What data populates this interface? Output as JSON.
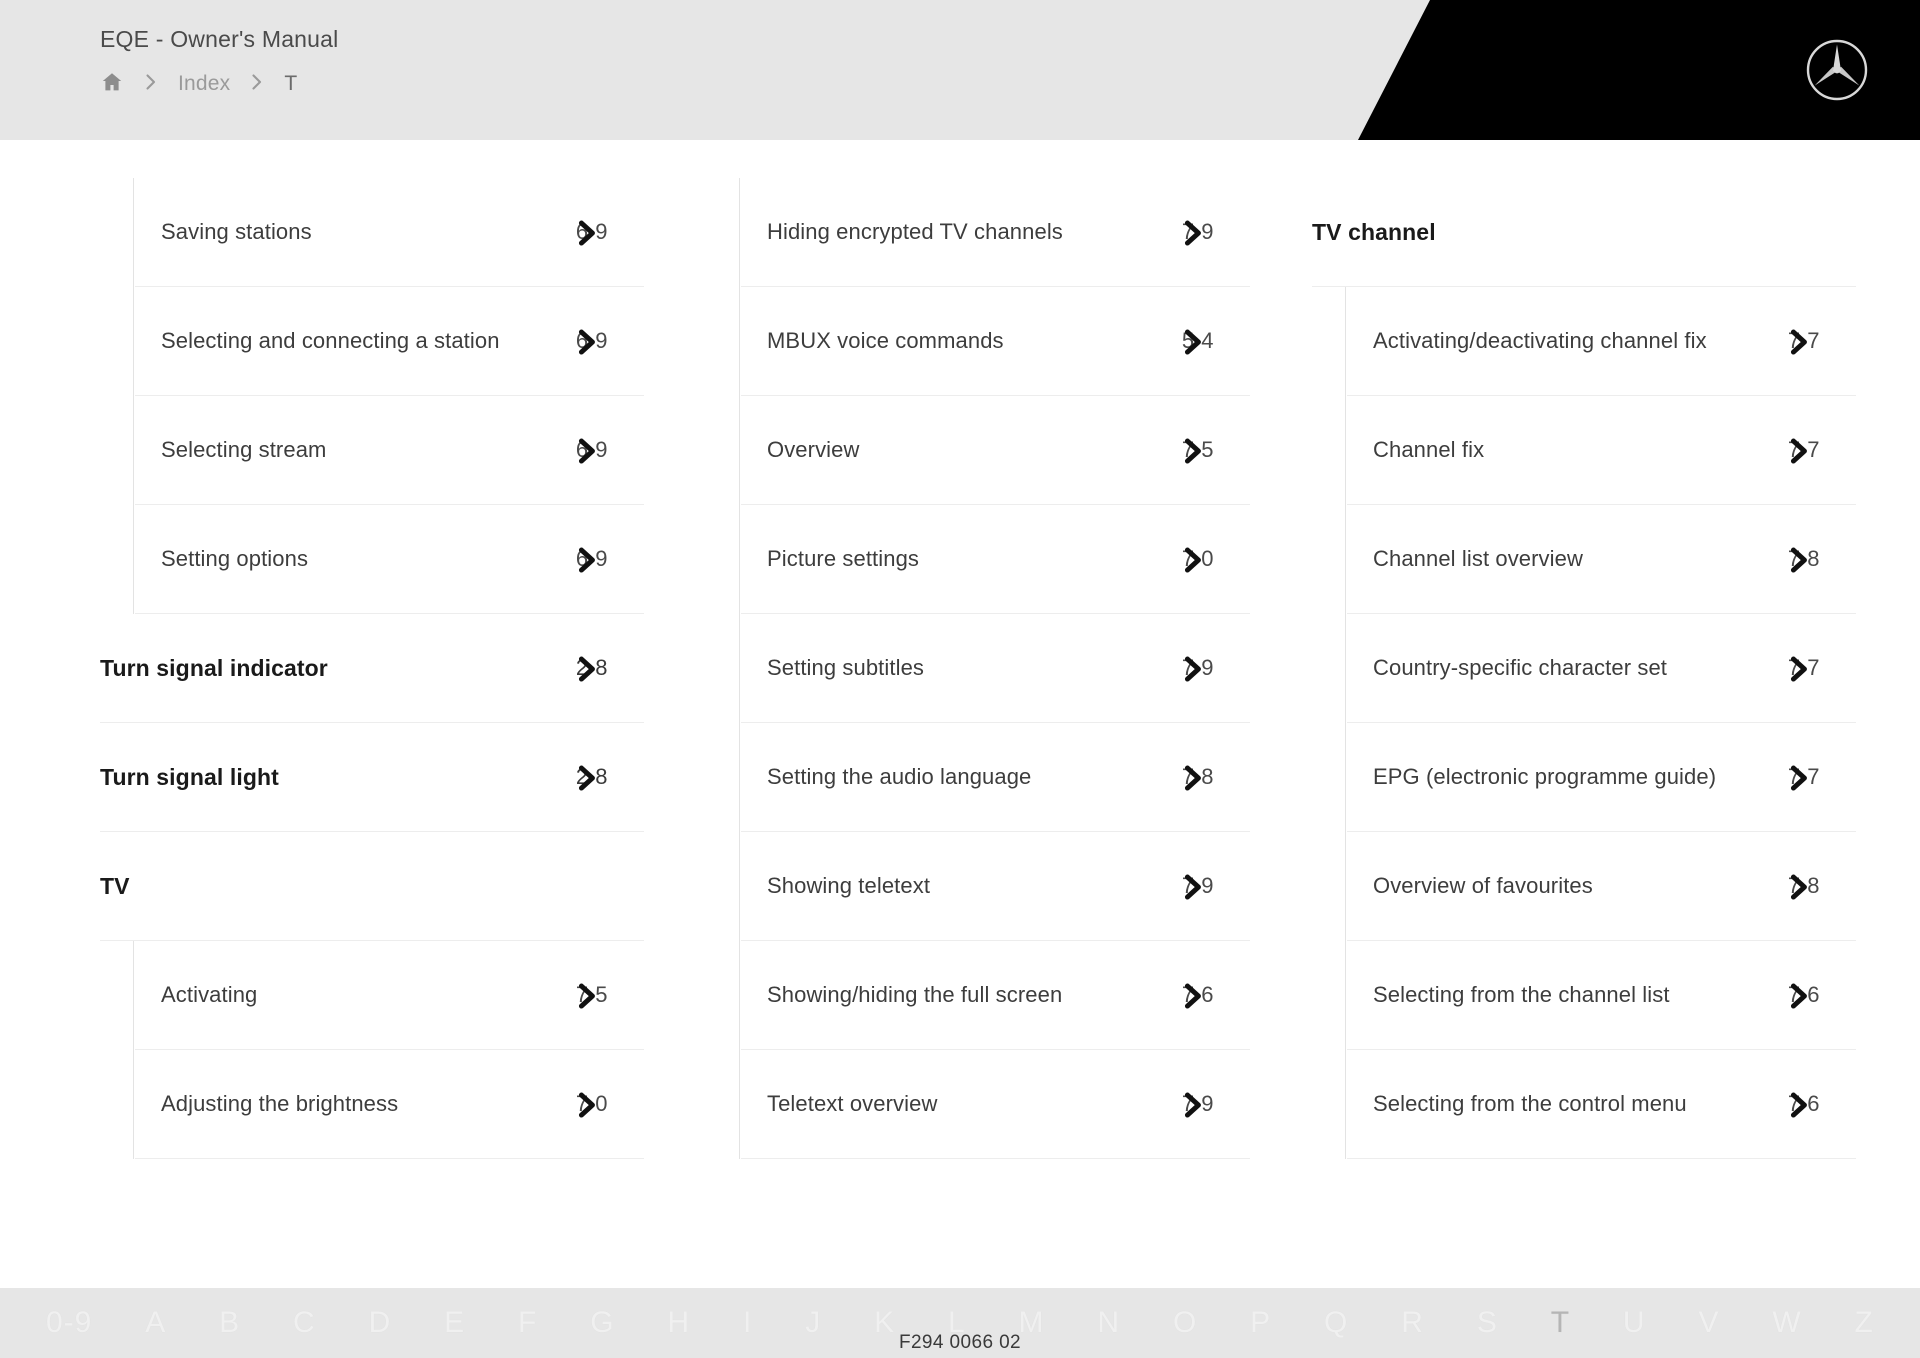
{
  "header": {
    "manual_title": "EQE - Owner's Manual",
    "breadcrumb": {
      "home_icon": "home-icon",
      "separator_icon": "chevron-right-icon",
      "items": [
        {
          "label": "Index",
          "current": false
        },
        {
          "label": "T",
          "current": true
        }
      ]
    },
    "brand_logo": "mercedes-benz-star-logo"
  },
  "index": {
    "columns": [
      {
        "id": "column-1",
        "blocks": [
          {
            "type": "subgroup",
            "entries": [
              {
                "label": "Saving stations",
                "page": "6 9"
              },
              {
                "label": "Selecting and connecting a station",
                "page": "6 9"
              },
              {
                "label": "Selecting stream",
                "page": "6 9"
              },
              {
                "label": "Setting options",
                "page": "6 9"
              }
            ]
          },
          {
            "type": "topentry",
            "entries": [
              {
                "label": "Turn signal indicator",
                "page": "2 8"
              },
              {
                "label": "Turn signal light",
                "page": "2 8"
              },
              {
                "label": "TV",
                "page": ""
              }
            ]
          },
          {
            "type": "subgroup",
            "entries": [
              {
                "label": "Activating",
                "page": "7 5"
              },
              {
                "label": "Adjusting the brightness",
                "page": "7 0"
              }
            ]
          }
        ]
      },
      {
        "id": "column-2",
        "blocks": [
          {
            "type": "subgroup",
            "entries": [
              {
                "label": "Hiding encrypted TV channels",
                "page": "7 9"
              },
              {
                "label": "MBUX voice commands",
                "page": "5 4"
              },
              {
                "label": "Overview",
                "page": "7 5"
              },
              {
                "label": "Picture settings",
                "page": "7 0"
              },
              {
                "label": "Setting subtitles",
                "page": "7 9"
              },
              {
                "label": "Setting the audio language",
                "page": "7 8"
              },
              {
                "label": "Showing teletext",
                "page": "7 9"
              },
              {
                "label": "Showing/hiding the full screen",
                "page": "7 6"
              },
              {
                "label": "Teletext overview",
                "page": "7 9"
              }
            ]
          }
        ]
      },
      {
        "id": "column-3",
        "blocks": [
          {
            "type": "topentry",
            "entries": [
              {
                "label": "TV channel",
                "page": ""
              }
            ]
          },
          {
            "type": "subgroup",
            "entries": [
              {
                "label": "Activating/deactivating channel fix",
                "page": "7 7"
              },
              {
                "label": "Channel fix",
                "page": "7 7"
              },
              {
                "label": "Channel list overview",
                "page": "7 8"
              },
              {
                "label": "Country-specific character set",
                "page": "7 7"
              },
              {
                "label": "EPG (electronic programme guide)",
                "page": "7 7"
              },
              {
                "label": "Overview of favourites",
                "page": "7 8"
              },
              {
                "label": "Selecting from the channel list",
                "page": "7 6"
              },
              {
                "label": "Selecting from the control menu",
                "page": "7 6"
              }
            ]
          }
        ]
      }
    ]
  },
  "footer": {
    "alphabet": [
      {
        "label": "0-9",
        "active": false
      },
      {
        "label": "A",
        "active": false
      },
      {
        "label": "B",
        "active": false
      },
      {
        "label": "C",
        "active": false
      },
      {
        "label": "D",
        "active": false
      },
      {
        "label": "E",
        "active": false
      },
      {
        "label": "F",
        "active": false
      },
      {
        "label": "G",
        "active": false
      },
      {
        "label": "H",
        "active": false
      },
      {
        "label": "I",
        "active": false
      },
      {
        "label": "J",
        "active": false
      },
      {
        "label": "K",
        "active": false
      },
      {
        "label": "L",
        "active": false
      },
      {
        "label": "M",
        "active": false
      },
      {
        "label": "N",
        "active": false
      },
      {
        "label": "O",
        "active": false
      },
      {
        "label": "P",
        "active": false
      },
      {
        "label": "Q",
        "active": false
      },
      {
        "label": "R",
        "active": false
      },
      {
        "label": "S",
        "active": false
      },
      {
        "label": "T",
        "active": true
      },
      {
        "label": "U",
        "active": false
      },
      {
        "label": "V",
        "active": false
      },
      {
        "label": "W",
        "active": false
      },
      {
        "label": "Z",
        "active": false
      }
    ],
    "doc_code": "F294 0066 02"
  },
  "colors": {
    "header_bg": "#e6e6e6",
    "header_accent": "#000000",
    "page_bg": "#ffffff",
    "divider": "#ededed",
    "text_primary": "#1a1a1a",
    "text_secondary": "#3d3d3d",
    "text_muted": "#9a9a9a",
    "footer_letter": "#f0f0f0",
    "footer_letter_active": "#b5b5b5"
  }
}
